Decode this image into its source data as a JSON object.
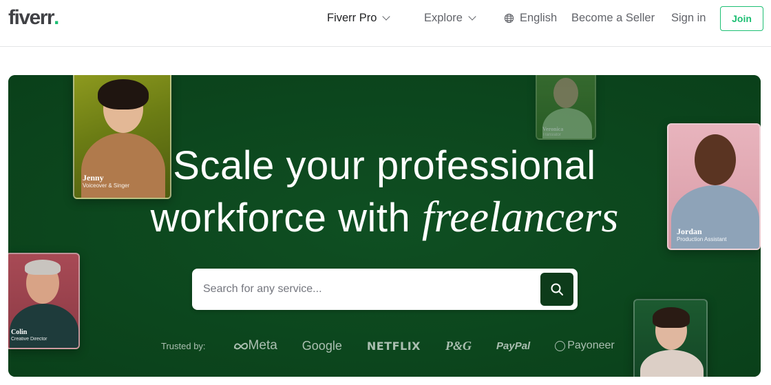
{
  "header": {
    "logo_text": "fiverr",
    "logo_dot": ".",
    "nav": {
      "fiverr_pro": "Fiverr Pro",
      "explore": "Explore",
      "language": "English",
      "become_seller": "Become a Seller",
      "sign_in": "Sign in",
      "join": "Join"
    }
  },
  "hero": {
    "headline_line1": "Scale your professional",
    "headline_line2_plain": "workforce with ",
    "headline_line2_italic": "freelancers",
    "search": {
      "placeholder": "Search for any service..."
    },
    "trusted_label": "Trusted by:",
    "brands": [
      "Meta",
      "Google",
      "NETFLIX",
      "P&G",
      "PayPal",
      "Payoneer"
    ],
    "freelancers": [
      {
        "name": "Jenny",
        "role": "Voiceover & Singer"
      },
      {
        "name": "Veronica",
        "role": "Translator"
      },
      {
        "name": "Jordan",
        "role": "Production Assistant"
      },
      {
        "name": "Colin",
        "role": "Creative Director"
      }
    ]
  },
  "colors": {
    "brand_green": "#1dbf73",
    "hero_bg": "#0d4b1f",
    "search_button": "#0d3b1a"
  }
}
